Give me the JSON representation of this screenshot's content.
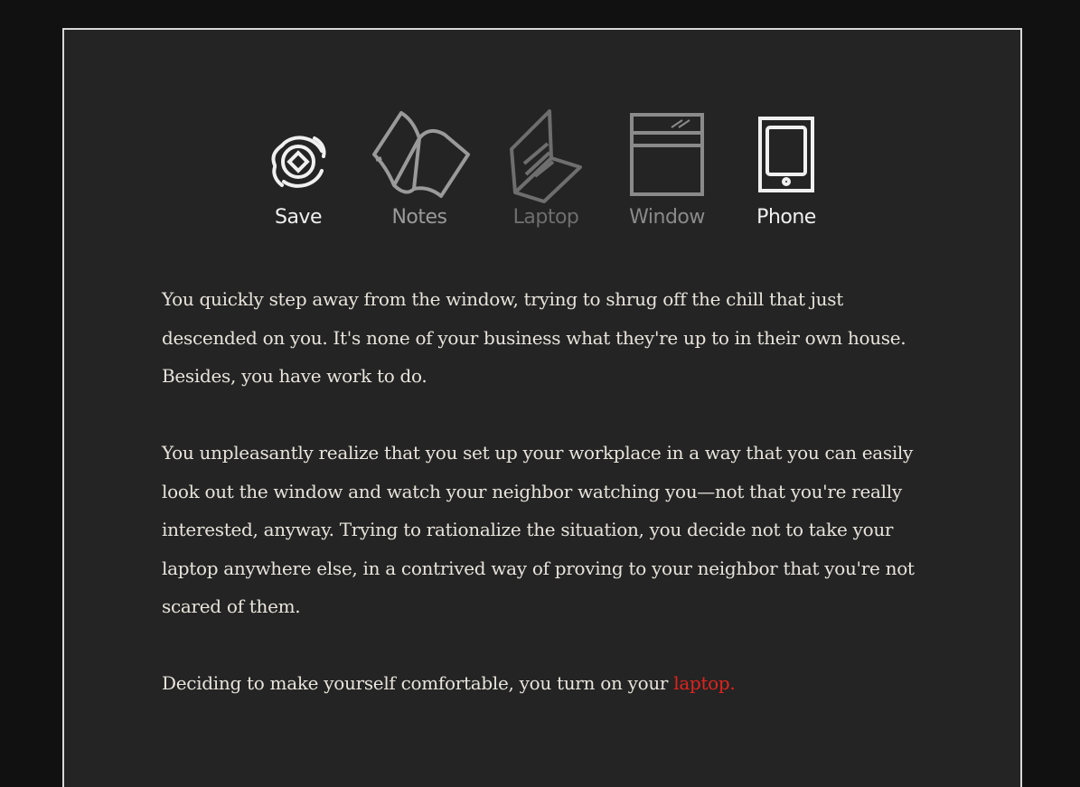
{
  "toolbar": {
    "items": [
      {
        "label": "Save",
        "icon": "save-icon",
        "color": "#f0f0f0"
      },
      {
        "label": "Notes",
        "icon": "notes-book-icon",
        "color": "#9a9a9a"
      },
      {
        "label": "Laptop",
        "icon": "laptop-icon",
        "color": "#6e6e6e"
      },
      {
        "label": "Window",
        "icon": "window-icon",
        "color": "#8a8a8a"
      },
      {
        "label": "Phone",
        "icon": "phone-icon",
        "color": "#f0f0f0"
      }
    ]
  },
  "story": {
    "paragraph_1": "You quickly step away from the window, trying to shrug off the chill that just descended on you. It's none of your business what they're up to in their own house. Besides, you have work to do.",
    "paragraph_2": "You unpleasantly realize that you set up your workplace in a way that you can easily look out the window and watch your neighbor watching you—not that you're really interested, anyway. Trying to rationalize the situation, you decide not to take your laptop anywhere else, in a contrived way of proving to your neighbor that you're not scared of them.",
    "paragraph_3_prefix": "Deciding to make yourself comfortable, you turn on your ",
    "paragraph_3_link": "laptop."
  },
  "colors": {
    "background": "#111111",
    "panel": "#242424",
    "panel_border": "#d8d8d8",
    "text": "#e8e4dc",
    "link": "#e0231e"
  }
}
